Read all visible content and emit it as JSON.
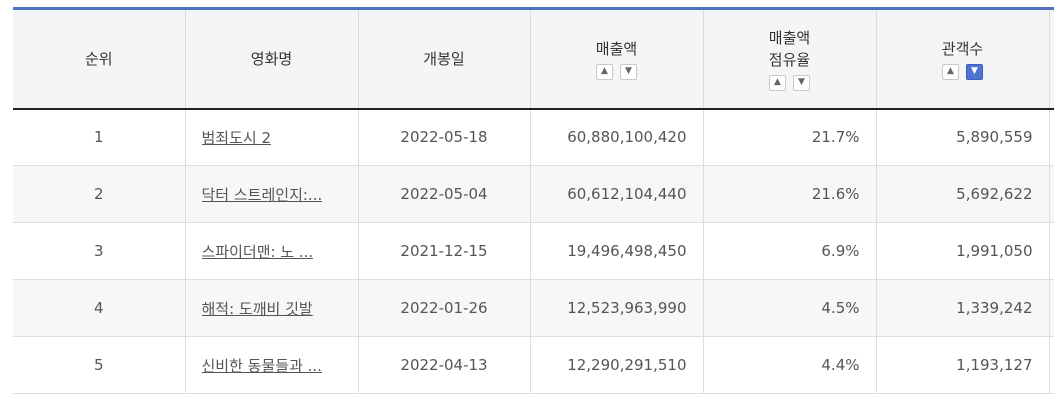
{
  "table": {
    "headers": {
      "rank": "순위",
      "title": "영화명",
      "release_date": "개봉일",
      "sales": "매출액",
      "share_line1": "매출액",
      "share_line2": "점유율",
      "audience": "관객수"
    },
    "sort_icons": {
      "up": "▲",
      "down": "▼"
    },
    "active_sort": {
      "column": "audience",
      "direction": "desc"
    },
    "rows": [
      {
        "rank": "1",
        "title": "범죄도시 2",
        "release_date": "2022-05-18",
        "sales": "60,880,100,420",
        "share": "21.7%",
        "audience": "5,890,559"
      },
      {
        "rank": "2",
        "title": "닥터 스트레인지:...",
        "release_date": "2022-05-04",
        "sales": "60,612,104,440",
        "share": "21.6%",
        "audience": "5,692,622"
      },
      {
        "rank": "3",
        "title": "스파이더맨: 노 ...",
        "release_date": "2021-12-15",
        "sales": "19,496,498,450",
        "share": "6.9%",
        "audience": "1,991,050"
      },
      {
        "rank": "4",
        "title": "해적: 도깨비 깃발",
        "release_date": "2022-01-26",
        "sales": "12,523,963,990",
        "share": "4.5%",
        "audience": "1,339,242"
      },
      {
        "rank": "5",
        "title": "신비한 동물들과 ...",
        "release_date": "2022-04-13",
        "sales": "12,290,291,510",
        "share": "4.4%",
        "audience": "1,193,127"
      }
    ]
  },
  "colors": {
    "header_top_border": "#4f74bd",
    "active_sort": "#4f74d0"
  }
}
